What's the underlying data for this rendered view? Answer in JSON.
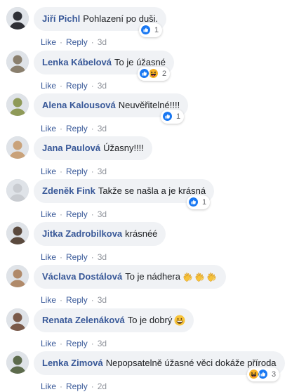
{
  "comments": [
    {
      "author": "Jiří Pichl",
      "text": "Pohlazení po duši.",
      "emoji": [],
      "actions": {
        "like": "Like",
        "reply": "Reply",
        "time": "3d"
      },
      "reactions": {
        "icons": [
          "like-icon"
        ],
        "count": "1"
      },
      "avatar_color": "#2f3036"
    },
    {
      "author": "Lenka Kábelová",
      "text": "To je úžasné",
      "emoji": [],
      "actions": {
        "like": "Like",
        "reply": "Reply",
        "time": "3d"
      },
      "reactions": {
        "icons": [
          "like-icon",
          "haha-icon"
        ],
        "count": "2"
      },
      "avatar_color": "#8a7f6d"
    },
    {
      "author": "Alena Kalousová",
      "text": "Neuvěřitelné!!!!",
      "emoji": [],
      "actions": {
        "like": "Like",
        "reply": "Reply",
        "time": "3d"
      },
      "reactions": {
        "icons": [
          "like-icon"
        ],
        "count": "1"
      },
      "avatar_color": "#8f9a58"
    },
    {
      "author": "Jana Paulová",
      "text": "Úžasny!!!!",
      "emoji": [],
      "actions": {
        "like": "Like",
        "reply": "Reply",
        "time": "3d"
      },
      "reactions": null,
      "avatar_color": "#c9a27a"
    },
    {
      "author": "Zdeněk Fink",
      "text": "Takže se našla a je krásná",
      "emoji": [],
      "actions": {
        "like": "Like",
        "reply": "Reply",
        "time": "3d"
      },
      "reactions": {
        "icons": [
          "like-icon"
        ],
        "count": "1"
      },
      "avatar_color": "#c9ccd1"
    },
    {
      "author": "Jitka Zadrobilkova",
      "text": "krásnéé",
      "emoji": [],
      "actions": {
        "like": "Like",
        "reply": "Reply",
        "time": "3d"
      },
      "reactions": null,
      "avatar_color": "#5b4a3e"
    },
    {
      "author": "Václava Dostálová",
      "text": "To je nádhera",
      "emoji": [
        "clapping-hands-icon",
        "clapping-hands-icon",
        "clapping-hands-icon"
      ],
      "actions": {
        "like": "Like",
        "reply": "Reply",
        "time": "3d"
      },
      "reactions": null,
      "avatar_color": "#b08a6a"
    },
    {
      "author": "Renata Zelenáková",
      "text": "To je dobrý",
      "emoji": [
        "grinning-face-icon"
      ],
      "actions": {
        "like": "Like",
        "reply": "Reply",
        "time": "3d"
      },
      "reactions": null,
      "avatar_color": "#7a5a4a"
    },
    {
      "author": "Lenka Zimová",
      "text": "Nepopsatelně úžasné věci dokáže příroda",
      "emoji": [],
      "actions": {
        "like": "Like",
        "reply": "Reply",
        "time": "2d"
      },
      "reactions": {
        "icons": [
          "haha-icon",
          "like-icon"
        ],
        "count": "3"
      },
      "avatar_color": "#5d6b4c"
    }
  ],
  "colors": {
    "author": "#385898",
    "bubble": "#f0f2f5",
    "like_reaction": "#1877f2",
    "haha_reaction": "#f7b125"
  }
}
